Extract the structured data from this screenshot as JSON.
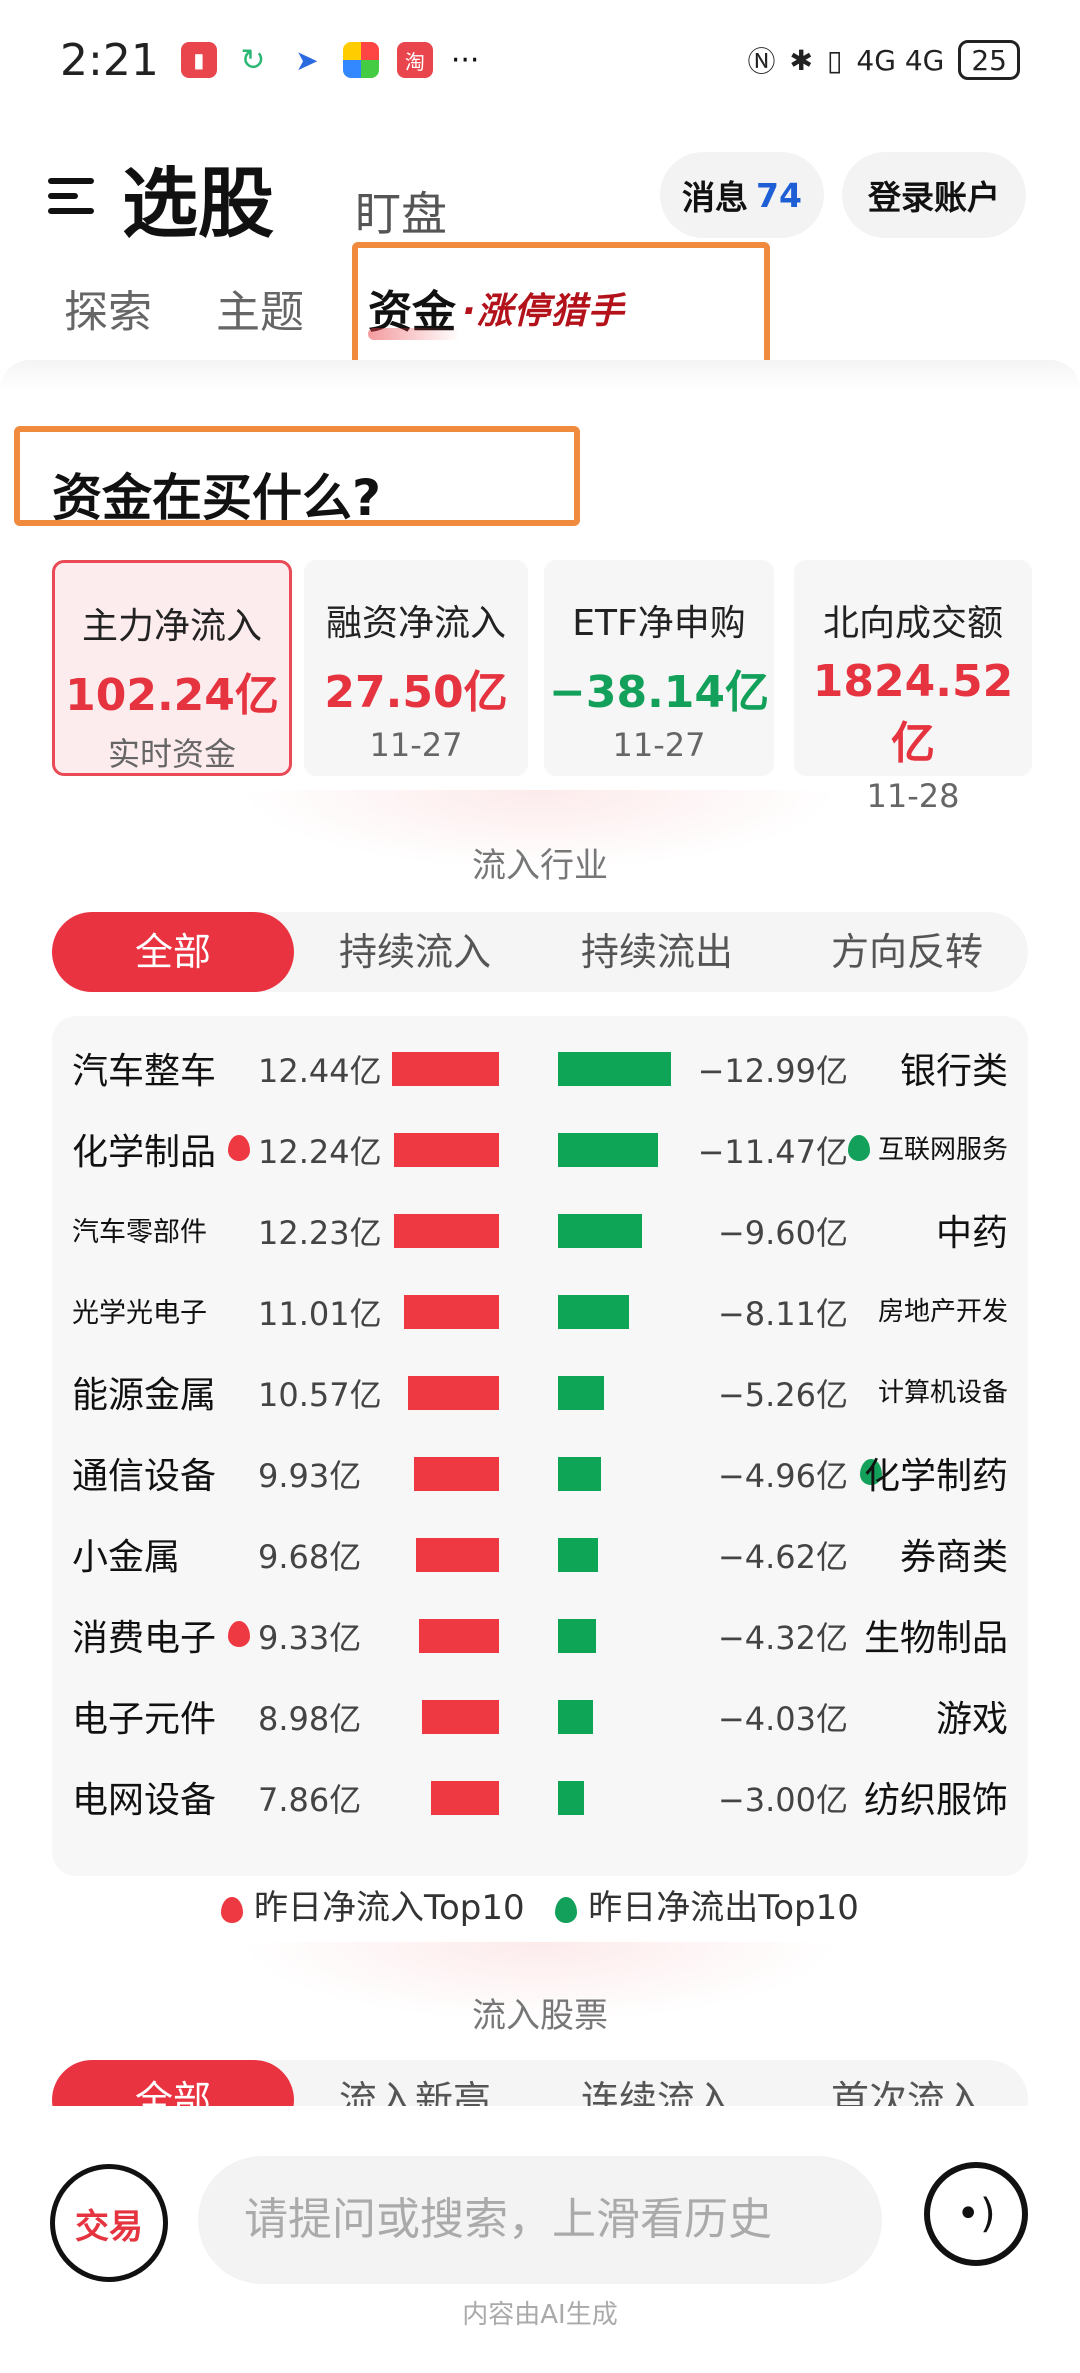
{
  "status": {
    "time": "2:21",
    "battery": "25",
    "more": "···",
    "signal": "4G 4G"
  },
  "header": {
    "title": "选股",
    "subtitle": "盯盘",
    "msg_label": "消息",
    "msg_count": "74",
    "login_label": "登录账户"
  },
  "tabs": [
    {
      "label": "探索"
    },
    {
      "label": "主题"
    },
    {
      "label": "资金"
    }
  ],
  "tab_badge": "·涨停猎手",
  "section_title": "资金在买什么?",
  "cards": [
    {
      "label": "主力净流入",
      "value": "102.24亿",
      "sub": "实时资金",
      "color": "red"
    },
    {
      "label": "融资净流入",
      "value": "27.50亿",
      "sub": "11-27",
      "color": "red"
    },
    {
      "label": "ETF净申购",
      "value": "−38.14亿",
      "sub": "11-27",
      "color": "green"
    },
    {
      "label": "北向成交额",
      "value": "1824.52亿",
      "sub": "11-28",
      "color": "red"
    }
  ],
  "inflow_heading": "流入行业",
  "industry_filters": [
    {
      "label": "全部"
    },
    {
      "label": "持续流入"
    },
    {
      "label": "持续流出"
    },
    {
      "label": "方向反转"
    }
  ],
  "industries": [
    {
      "in_name": "汽车整车",
      "in_value": "12.44亿",
      "in_amount": 12.44,
      "in_fire": false,
      "out_value": "−12.99亿",
      "out_amount": 12.99,
      "out_name": "银行类",
      "out_fire": false
    },
    {
      "in_name": "化学制品",
      "in_value": "12.24亿",
      "in_amount": 12.24,
      "in_fire": true,
      "out_value": "−11.47亿",
      "out_amount": 11.47,
      "out_name": "互联网服务",
      "out_fire": true
    },
    {
      "in_name": "汽车零部件",
      "in_value": "12.23亿",
      "in_amount": 12.23,
      "in_fire": false,
      "out_value": "−9.60亿",
      "out_amount": 9.6,
      "out_name": "中药",
      "out_fire": false
    },
    {
      "in_name": "光学光电子",
      "in_value": "11.01亿",
      "in_amount": 11.01,
      "in_fire": false,
      "out_value": "−8.11亿",
      "out_amount": 8.11,
      "out_name": "房地产开发",
      "out_fire": false
    },
    {
      "in_name": "能源金属",
      "in_value": "10.57亿",
      "in_amount": 10.57,
      "in_fire": false,
      "out_value": "−5.26亿",
      "out_amount": 5.26,
      "out_name": "计算机设备",
      "out_fire": false
    },
    {
      "in_name": "通信设备",
      "in_value": "9.93亿",
      "in_amount": 9.93,
      "in_fire": false,
      "out_value": "−4.96亿",
      "out_amount": 4.96,
      "out_name": "化学制药",
      "out_fire": true
    },
    {
      "in_name": "小金属",
      "in_value": "9.68亿",
      "in_amount": 9.68,
      "in_fire": false,
      "out_value": "−4.62亿",
      "out_amount": 4.62,
      "out_name": "券商类",
      "out_fire": false
    },
    {
      "in_name": "消费电子",
      "in_value": "9.33亿",
      "in_amount": 9.33,
      "in_fire": true,
      "out_value": "−4.32亿",
      "out_amount": 4.32,
      "out_name": "生物制品",
      "out_fire": false
    },
    {
      "in_name": "电子元件",
      "in_value": "8.98亿",
      "in_amount": 8.98,
      "in_fire": false,
      "out_value": "−4.03亿",
      "out_amount": 4.03,
      "out_name": "游戏",
      "out_fire": false
    },
    {
      "in_name": "电网设备",
      "in_value": "7.86亿",
      "in_amount": 7.86,
      "in_fire": false,
      "out_value": "−3.00亿",
      "out_amount": 3.0,
      "out_name": "纺织服饰",
      "out_fire": false
    }
  ],
  "legend": {
    "in_label": "昨日净流入Top10",
    "out_label": "昨日净流出Top10"
  },
  "stocks_heading": "流入股票",
  "stock_filters": [
    {
      "label": "全部"
    },
    {
      "label": "流入新高"
    },
    {
      "label": "连续流入"
    },
    {
      "label": "首次流入"
    }
  ],
  "bottom": {
    "trade_label": "交易",
    "search_placeholder": "请提问或搜索，上滑看历史",
    "ai_note": "内容由AI生成"
  },
  "colors": {
    "accent_red": "#ea3341",
    "inflow_red": "#ee3942",
    "outflow_green": "#0ea556",
    "highlight_orange": "#f08a3c"
  }
}
